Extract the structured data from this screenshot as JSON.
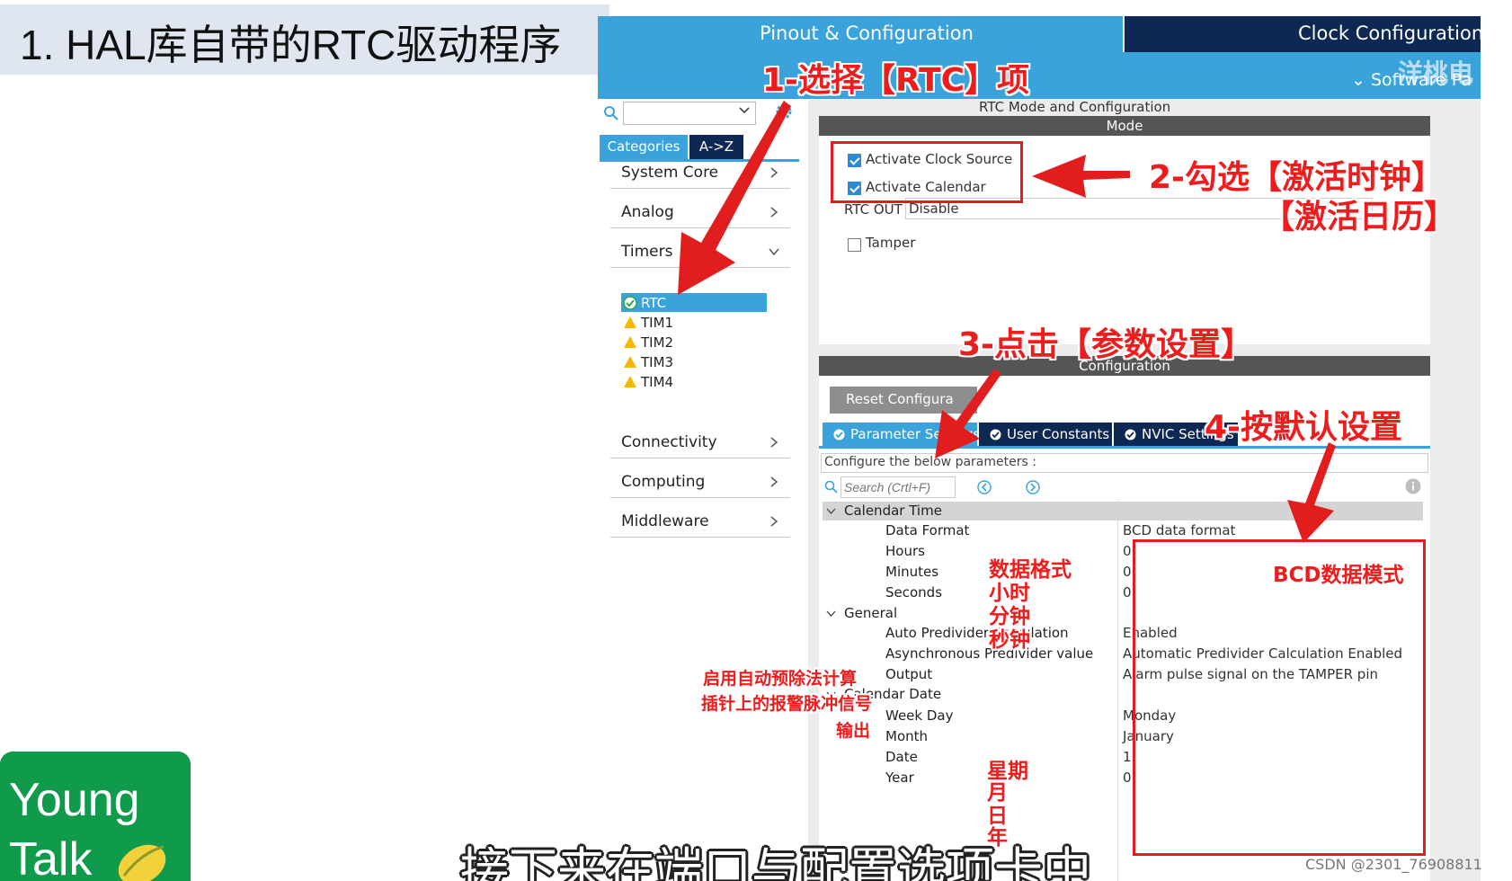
{
  "slide": {
    "title": "1. HAL库自带的RTC驱动程序"
  },
  "window": {
    "tab_pinout": "Pinout & Configuration",
    "tab_clock": "Clock Configuration",
    "software_packs": "Software Pa",
    "watermark": "洋桃电"
  },
  "left_panel": {
    "search_value": "",
    "btn_categories": "Categories",
    "btn_az": "A->Z",
    "categories": [
      {
        "label": "System Core"
      },
      {
        "label": "Analog"
      },
      {
        "label": "Timers"
      },
      {
        "label": "Connectivity"
      },
      {
        "label": "Computing"
      },
      {
        "label": "Middleware"
      }
    ],
    "timers": [
      {
        "label": "RTC",
        "status": "ok"
      },
      {
        "label": "TIM1",
        "status": "warning"
      },
      {
        "label": "TIM2",
        "status": "warning"
      },
      {
        "label": "TIM3",
        "status": "warning"
      },
      {
        "label": "TIM4",
        "status": "warning"
      }
    ]
  },
  "mode": {
    "title": "RTC Mode and Configuration",
    "header": "Mode",
    "activate_clock_source": {
      "label": "Activate Clock Source",
      "checked": true
    },
    "activate_calendar": {
      "label": "Activate Calendar",
      "checked": true
    },
    "rtc_out_label": "RTC OUT",
    "rtc_out_value": "Disable",
    "tamper": {
      "label": "Tamper",
      "checked": false
    }
  },
  "configuration": {
    "header": "Configuration",
    "reset_button": "Reset Configura",
    "tabs": [
      {
        "label": "Parameter Settings",
        "active": true
      },
      {
        "label": "User Constants",
        "active": false
      },
      {
        "label": "NVIC Settings",
        "active": false
      }
    ],
    "hint": "Configure the below parameters :",
    "search_placeholder": "Search (Crtl+F)",
    "groups": {
      "calendar_time": "Calendar Time",
      "general": "General",
      "calendar_date": "Calendar Date"
    },
    "params": [
      {
        "name": "Data Format",
        "value": "BCD data format"
      },
      {
        "name": "Hours",
        "value": "0"
      },
      {
        "name": "Minutes",
        "value": "0"
      },
      {
        "name": "Seconds",
        "value": "0"
      },
      {
        "name": "Auto Predivider Calculation",
        "value": "Enabled"
      },
      {
        "name": "Asynchronous Predivider value",
        "value": "Automatic Predivider Calculation Enabled"
      },
      {
        "name": "Output",
        "value": "Alarm pulse signal on the TAMPER pin"
      },
      {
        "name": "Week Day",
        "value": "Monday"
      },
      {
        "name": "Month",
        "value": "January"
      },
      {
        "name": "Date",
        "value": "1"
      },
      {
        "name": "Year",
        "value": "0"
      }
    ]
  },
  "annotations": {
    "step1": "1-选择【RTC】项",
    "step2_line1": "2-勾选【激活时钟】",
    "step2_line2": "【激活日历】",
    "step3": "3-点击【参数设置】",
    "step4": "4-按默认设置",
    "bcd_mode": "BCD数据模式",
    "data_format": "数据格式",
    "hours": "小时",
    "minutes": "分钟",
    "seconds": "秒钟",
    "auto_predivider": "启用自动预除法计算",
    "alarm_pin": "插针上的报警脉冲信号",
    "output": "输出",
    "week_day": "星期",
    "month": "月",
    "date": "日",
    "year": "年"
  },
  "logo": {
    "line1": "Young",
    "line2": "Talk"
  },
  "subtitle": "接下来在端口与配置选项卡中",
  "credit": "CSDN @2301_76908811",
  "colors": {
    "tab_blue": "#3aa3dc",
    "tab_navy": "#0d2852",
    "annotation_red": "#ee1c1c",
    "logo_green": "#0f9a4c",
    "warning_yellow": "#f5b800",
    "ok_green": "#2aa84a"
  }
}
